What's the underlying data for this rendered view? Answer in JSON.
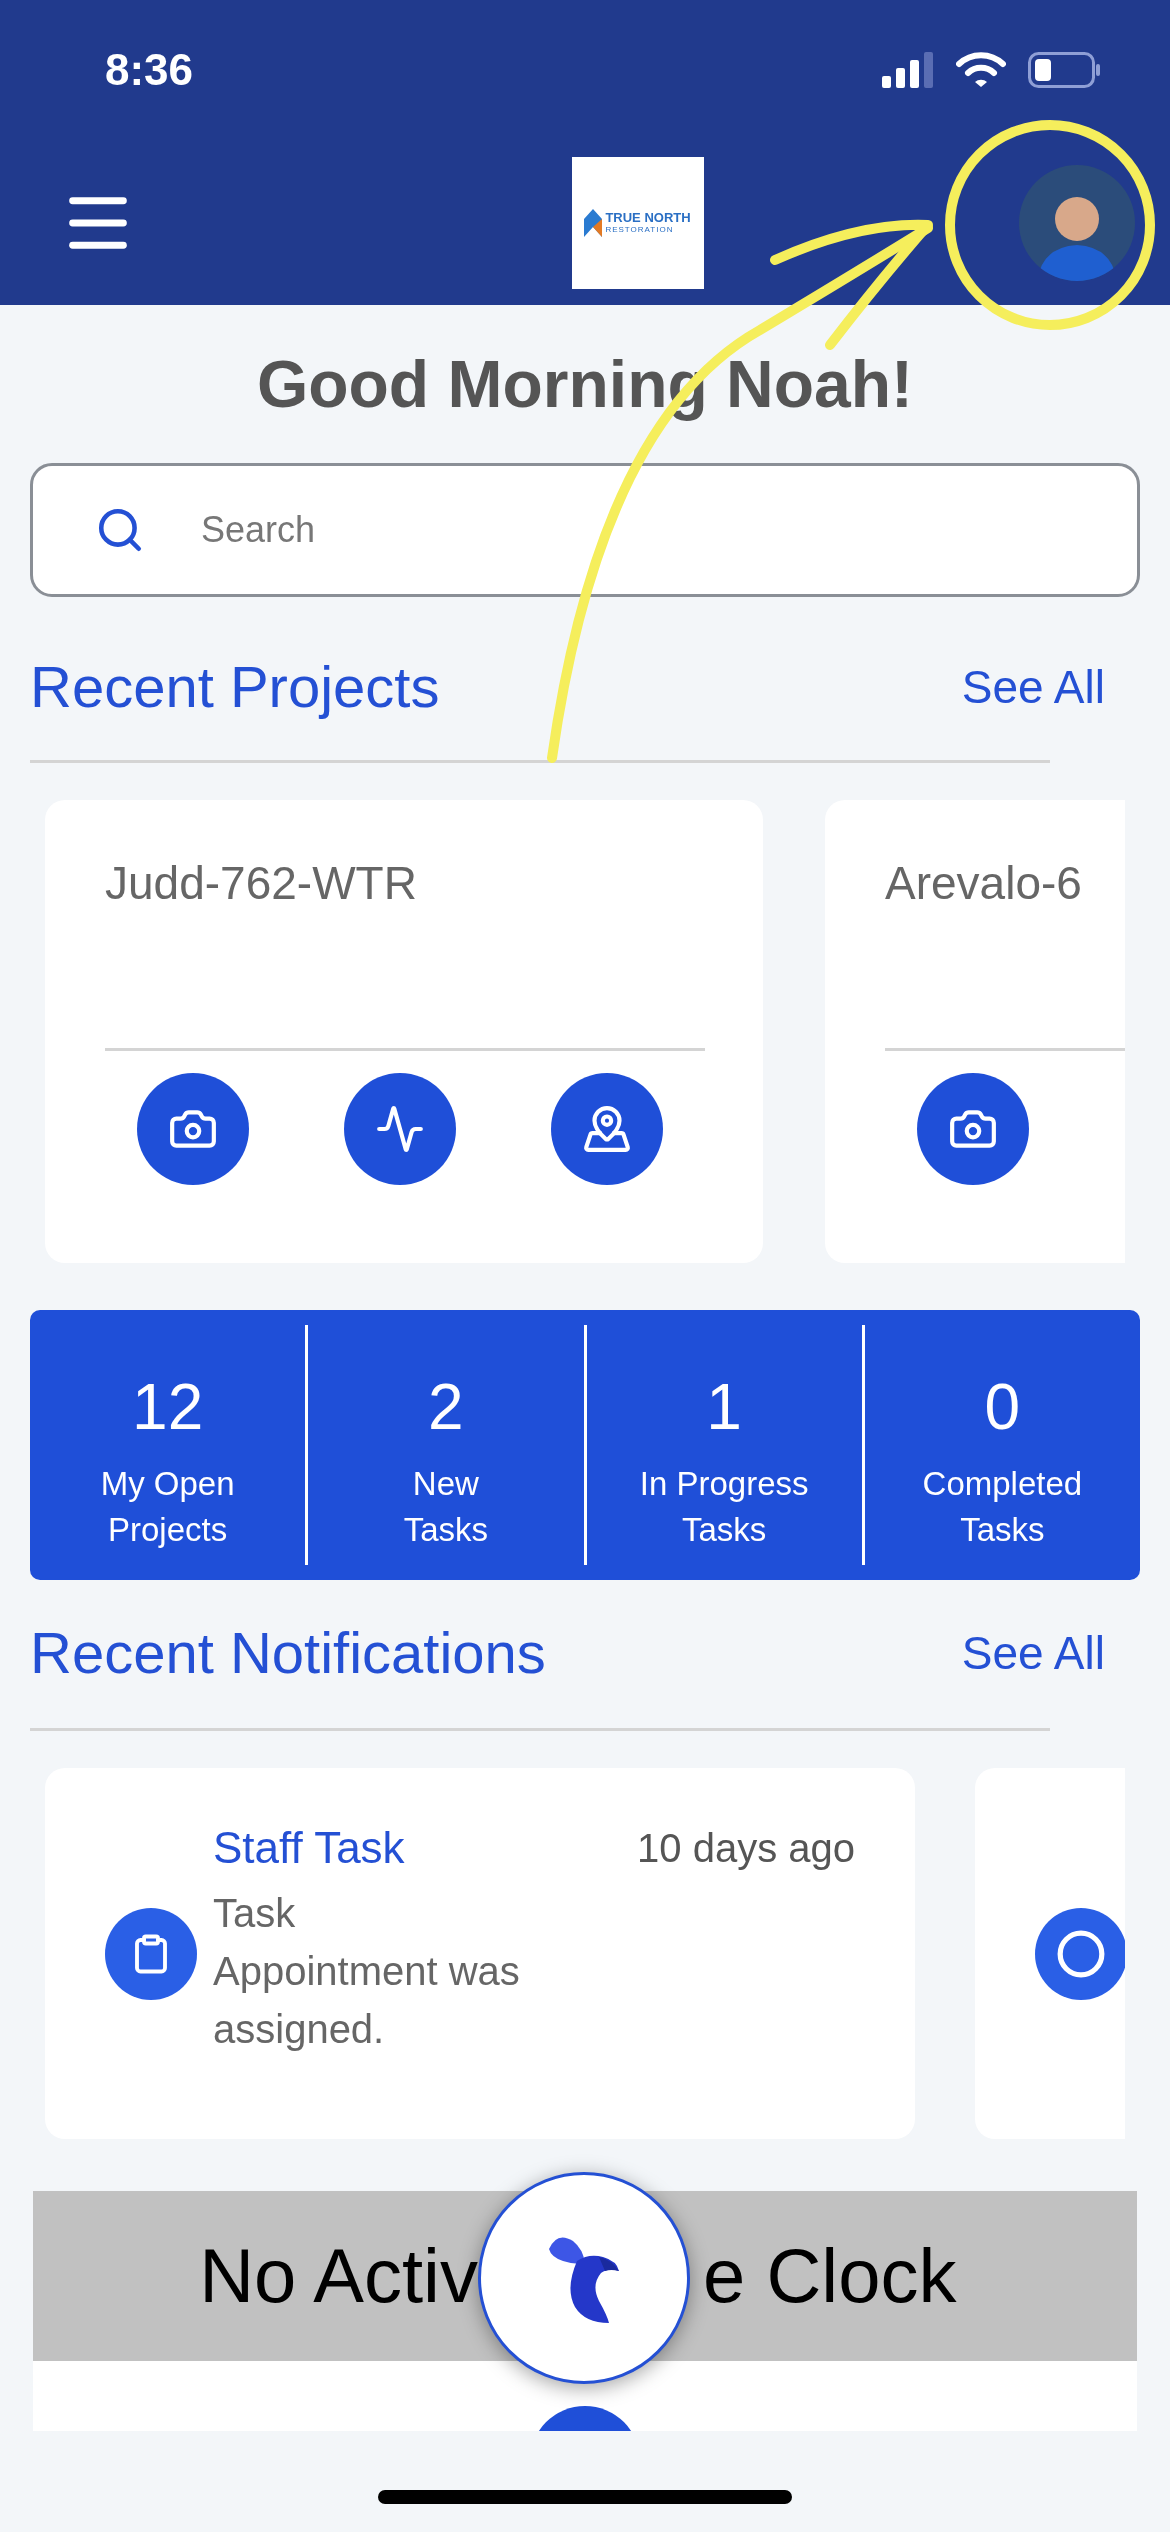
{
  "status_bar": {
    "time": "8:36"
  },
  "header": {
    "logo": {
      "name": "TRUE NORTH",
      "tagline": "RESTORATION"
    }
  },
  "greeting": "Good Morning Noah!",
  "search": {
    "placeholder": "Search"
  },
  "recent_projects": {
    "title": "Recent Projects",
    "see_all": "See All",
    "projects": [
      {
        "name": "Judd-762-WTR",
        "actions": [
          {
            "kind": "camera"
          },
          {
            "kind": "activity"
          },
          {
            "kind": "map"
          }
        ]
      },
      {
        "name": "Arevalo-6",
        "actions": [
          {
            "kind": "camera"
          }
        ]
      }
    ]
  },
  "stats": [
    {
      "value": "12",
      "label_lines": [
        "My Open",
        "Projects"
      ]
    },
    {
      "value": "2",
      "label_lines": [
        "New",
        "Tasks"
      ]
    },
    {
      "value": "1",
      "label_lines": [
        "In Progress",
        "Tasks"
      ]
    },
    {
      "value": "0",
      "label_lines": [
        "Completed",
        "Tasks"
      ]
    }
  ],
  "recent_notifications": {
    "title": "Recent Notifications",
    "see_all": "See All",
    "items": [
      {
        "kind": "task",
        "title": "Staff Task",
        "time": "10 days ago",
        "body_lines": [
          "Task",
          "Appointment was",
          "assigned."
        ]
      },
      {
        "kind": "other"
      }
    ]
  },
  "time_clock_banner": {
    "text_left": "No Activ",
    "text_right": "e Clock"
  }
}
